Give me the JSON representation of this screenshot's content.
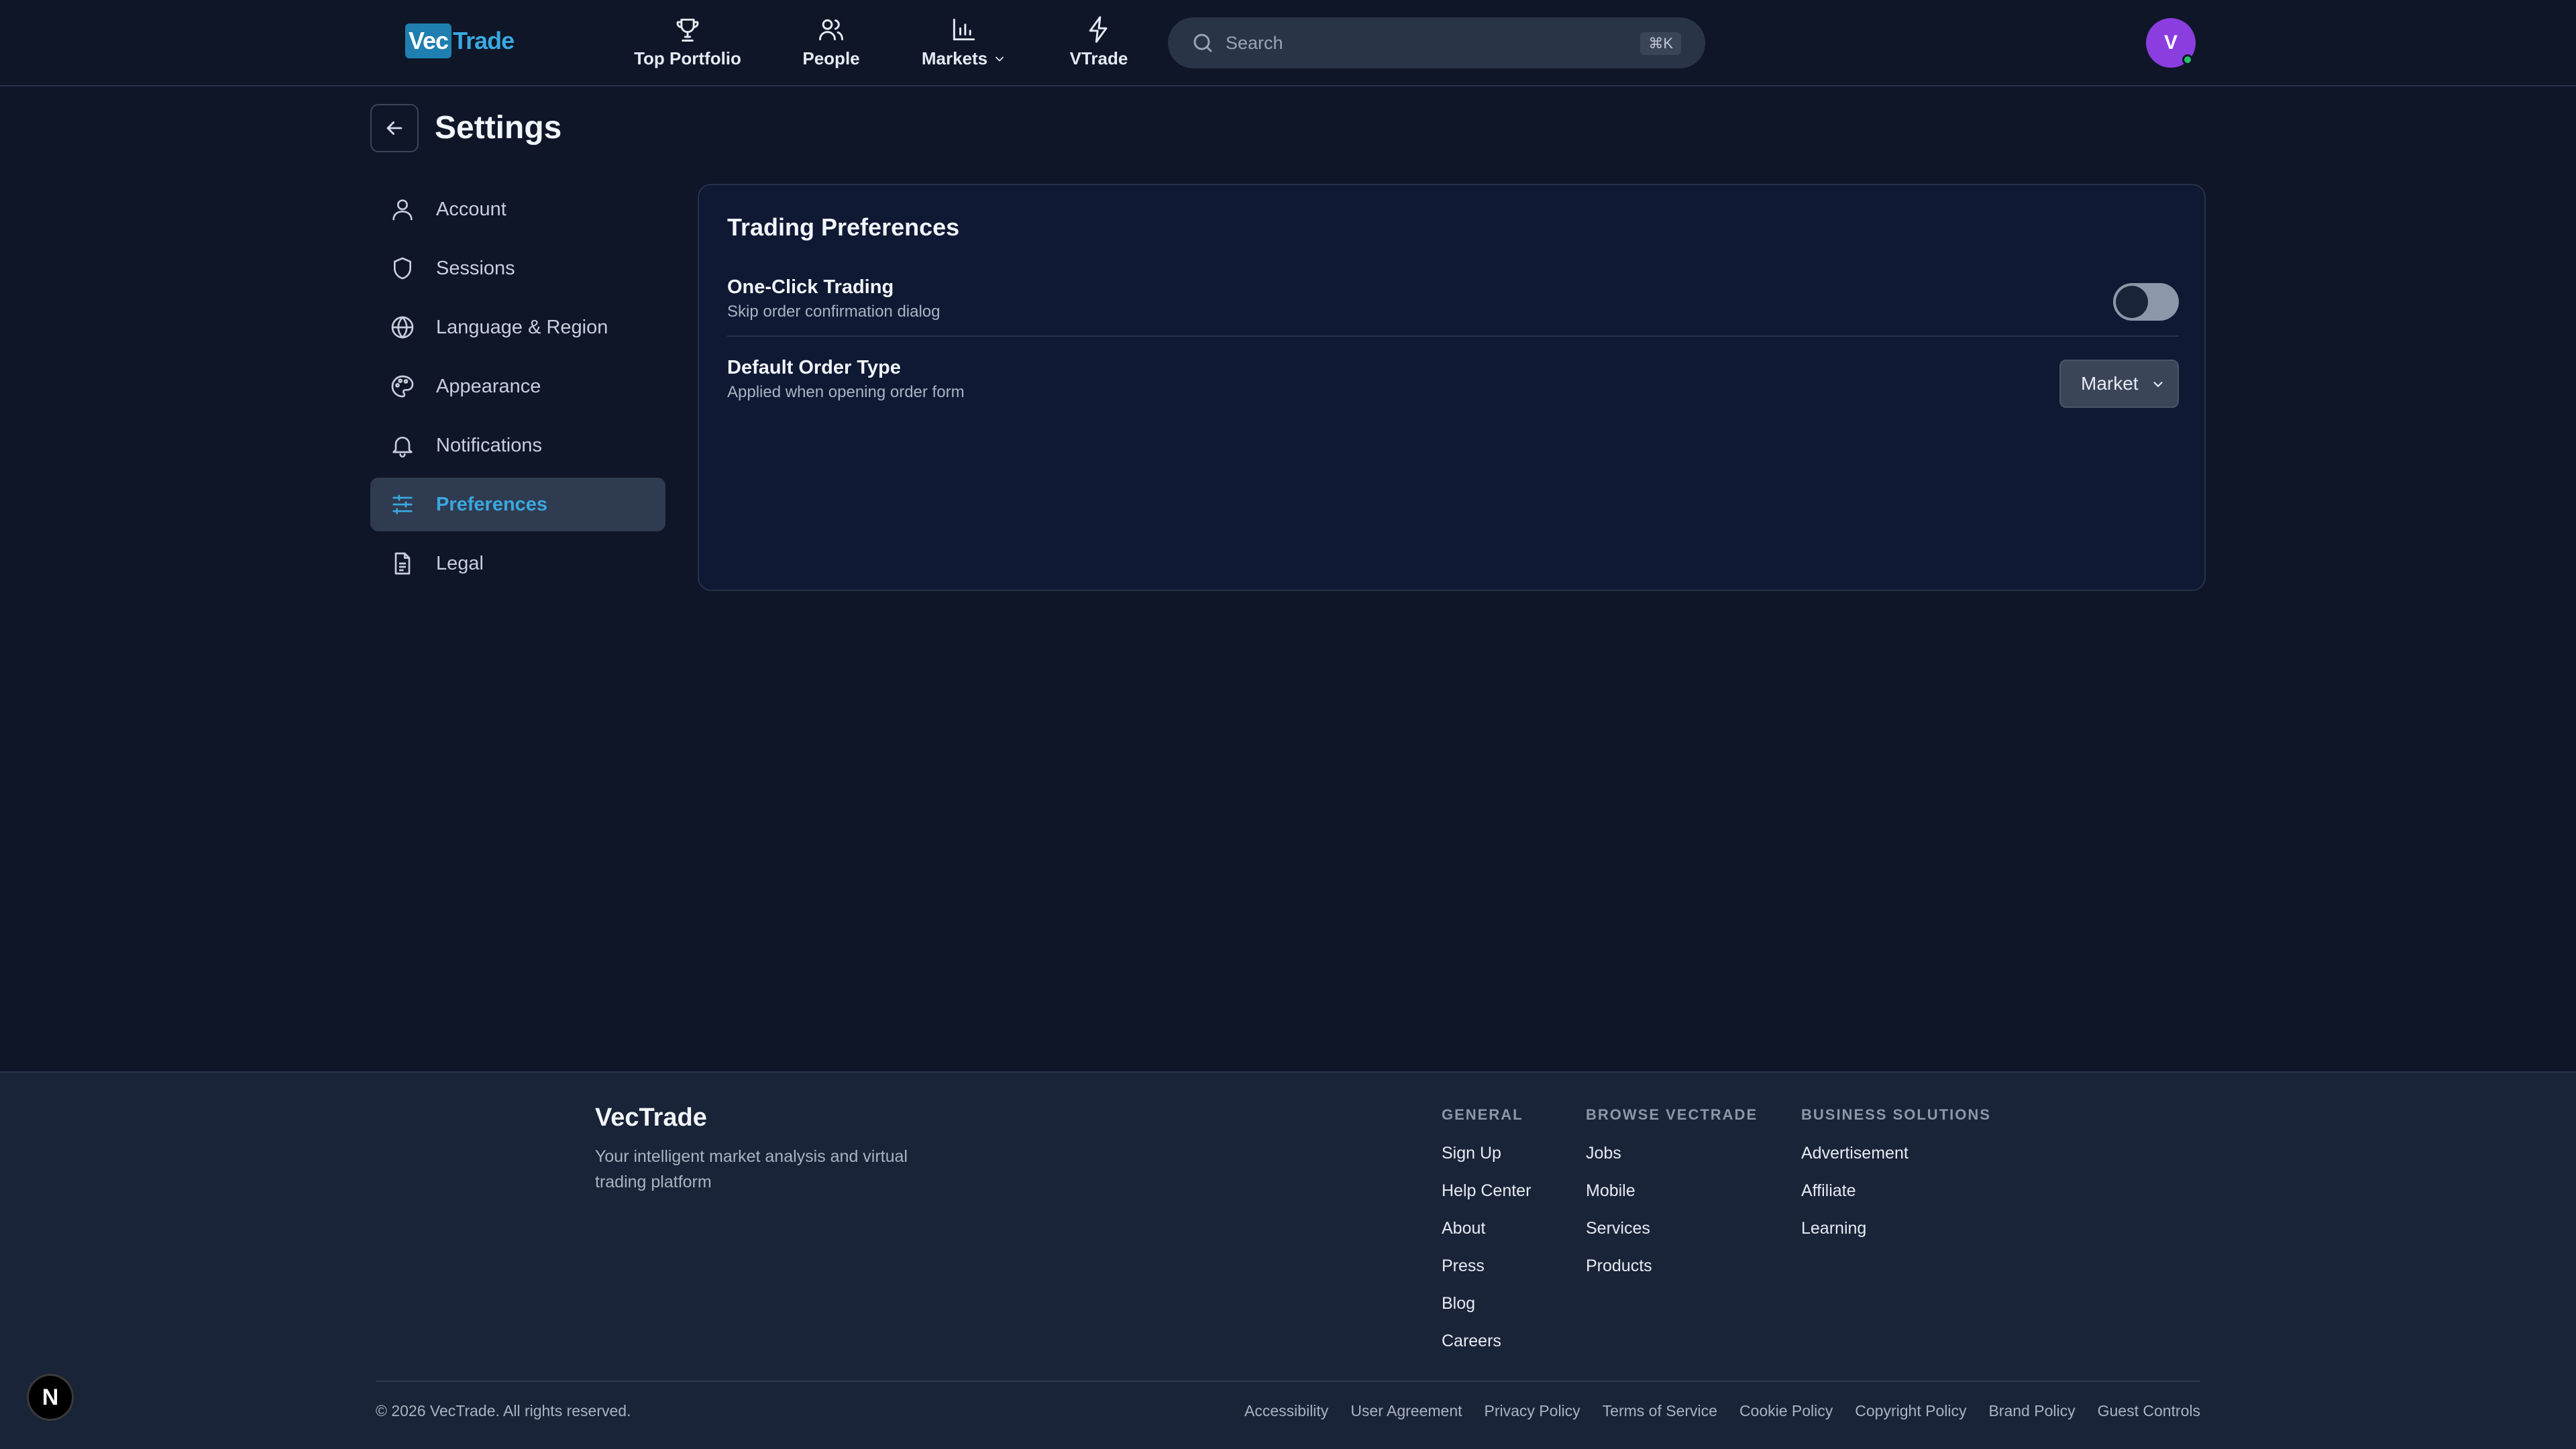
{
  "brand": {
    "logo_part1": "Vec",
    "logo_part2": "Trade",
    "name": "VecTrade"
  },
  "nav": {
    "items": [
      {
        "label": "Top Portfolio",
        "icon": "trophy-icon"
      },
      {
        "label": "People",
        "icon": "people-icon"
      },
      {
        "label": "Markets",
        "icon": "bar-chart-icon"
      },
      {
        "label": "VTrade",
        "icon": "lightning-icon"
      }
    ]
  },
  "search": {
    "placeholder": "Search",
    "shortcut": "⌘K"
  },
  "user": {
    "avatar_initial": "V"
  },
  "page": {
    "title": "Settings"
  },
  "sidebar": {
    "items": [
      {
        "label": "Account",
        "icon": "user-icon"
      },
      {
        "label": "Sessions",
        "icon": "shield-icon"
      },
      {
        "label": "Language & Region",
        "icon": "globe-icon"
      },
      {
        "label": "Appearance",
        "icon": "palette-icon"
      },
      {
        "label": "Notifications",
        "icon": "bell-icon"
      },
      {
        "label": "Preferences",
        "icon": "sliders-icon",
        "active": true
      },
      {
        "label": "Legal",
        "icon": "document-icon"
      }
    ]
  },
  "trading_preferences": {
    "title": "Trading Preferences",
    "one_click": {
      "label": "One-Click Trading",
      "description": "Skip order confirmation dialog",
      "enabled": false
    },
    "order_type": {
      "label": "Default Order Type",
      "description": "Applied when opening order form",
      "value": "Market"
    }
  },
  "footer": {
    "tagline": "Your intelligent market analysis and virtual trading platform",
    "columns": [
      {
        "heading": "GENERAL",
        "links": [
          "Sign Up",
          "Help Center",
          "About",
          "Press",
          "Blog",
          "Careers"
        ]
      },
      {
        "heading": "BROWSE VECTRADE",
        "links": [
          "Jobs",
          "Mobile",
          "Services",
          "Products"
        ]
      },
      {
        "heading": "BUSINESS SOLUTIONS",
        "links": [
          "Advertisement",
          "Affiliate",
          "Learning"
        ]
      }
    ],
    "copyright": "© 2026 VecTrade. All rights reserved.",
    "legal_links": [
      "Accessibility",
      "User Agreement",
      "Privacy Policy",
      "Terms of Service",
      "Cookie Policy",
      "Copyright Policy",
      "Brand Policy",
      "Guest Controls"
    ]
  },
  "dev_badge": {
    "label": "N"
  },
  "colors": {
    "accent": "#3aa8e0",
    "background": "#0e1628",
    "card": "#0f1934",
    "footer": "#1a2438",
    "avatar": "#8b3de0",
    "online": "#21c26b"
  }
}
